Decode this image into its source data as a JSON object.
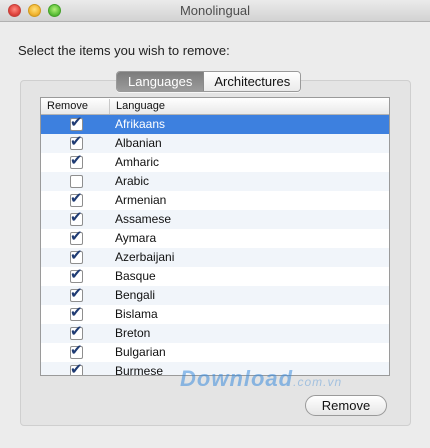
{
  "window": {
    "title": "Monolingual"
  },
  "prompt": "Select the items you wish to remove:",
  "tabs": [
    {
      "label": "Languages",
      "active": true
    },
    {
      "label": "Architectures",
      "active": false
    }
  ],
  "table": {
    "columns": {
      "remove": "Remove",
      "language": "Language"
    },
    "rows": [
      {
        "language": "Afrikaans",
        "checked": true,
        "selected": true
      },
      {
        "language": "Albanian",
        "checked": true
      },
      {
        "language": "Amharic",
        "checked": true
      },
      {
        "language": "Arabic",
        "checked": false
      },
      {
        "language": "Armenian",
        "checked": true
      },
      {
        "language": "Assamese",
        "checked": true
      },
      {
        "language": "Aymara",
        "checked": true
      },
      {
        "language": "Azerbaijani",
        "checked": true
      },
      {
        "language": "Basque",
        "checked": true
      },
      {
        "language": "Bengali",
        "checked": true
      },
      {
        "language": "Bislama",
        "checked": true
      },
      {
        "language": "Breton",
        "checked": true
      },
      {
        "language": "Bulgarian",
        "checked": true
      },
      {
        "language": "Burmese",
        "checked": true
      }
    ]
  },
  "buttons": {
    "remove": "Remove"
  },
  "watermark": {
    "text": "Download",
    "sub": ".com.vn"
  },
  "colors": {
    "selection": "#3d80df",
    "checkmark": "#1f3b73",
    "alt_row": "#f1f5fa"
  }
}
